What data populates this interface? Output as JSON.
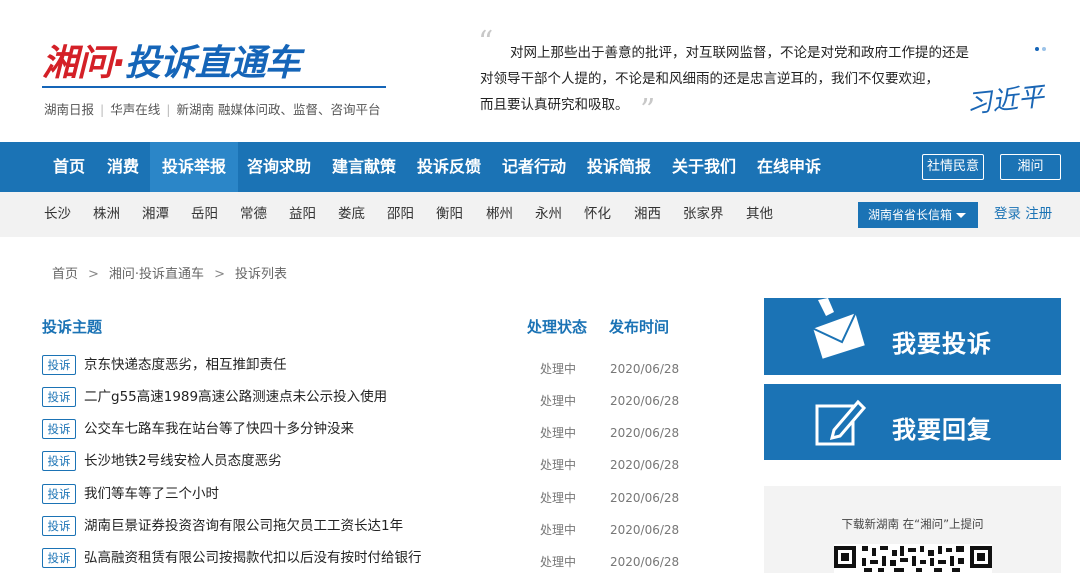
{
  "header": {
    "logo_red": "湘问",
    "logo_dot": "·",
    "logo_blue": "投诉直通车",
    "tagline": [
      "湖南日报",
      "华声在线",
      "新湖南 融媒体问政、监督、咨询平台"
    ],
    "quote_line1": "对网上那些出于善意的批评，对互联网监督，不论是对党和政府工作提的还是",
    "quote_line2": "对领导干部个人提的，不论是和风细雨的还是忠言逆耳的，我们不仅要欢迎，",
    "quote_line3": "而且要认真研究和吸取。",
    "signature": "习近平"
  },
  "mainnav": {
    "items": [
      "首页",
      "消费",
      "投诉举报",
      "咨询求助",
      "建言献策",
      "投诉反馈",
      "记者行动",
      "投诉简报",
      "关于我们",
      "在线申诉"
    ],
    "btn_shequ": "社情民意",
    "btn_xiangwen": "湘问"
  },
  "regionnav": {
    "regions": [
      "长沙",
      "株洲",
      "湘潭",
      "岳阳",
      "常德",
      "益阳",
      "娄底",
      "邵阳",
      "衡阳",
      "郴州",
      "永州",
      "怀化",
      "湘西",
      "张家界",
      "其他"
    ],
    "mailbox": "湖南省省长信箱",
    "login": "登录",
    "register": "注册"
  },
  "breadcrumb": [
    "首页",
    "湘问·投诉直通车",
    "投诉列表"
  ],
  "list": {
    "col_subject": "投诉主题",
    "col_status": "处理状态",
    "col_date": "发布时间",
    "rows": [
      {
        "tag": "投诉",
        "title": "京东快递态度恶劣，相互推卸责任",
        "status": "处理中",
        "date": "2020/06/28"
      },
      {
        "tag": "投诉",
        "title": "二广g55高速1989高速公路测速点未公示投入使用",
        "status": "处理中",
        "date": "2020/06/28"
      },
      {
        "tag": "投诉",
        "title": "公交车七路车我在站台等了快四十多分钟没来",
        "status": "处理中",
        "date": "2020/06/28"
      },
      {
        "tag": "投诉",
        "title": "长沙地铁2号线安检人员态度恶劣",
        "status": "处理中",
        "date": "2020/06/28"
      },
      {
        "tag": "投诉",
        "title": "我们等车等了三个小时",
        "status": "处理中",
        "date": "2020/06/28"
      },
      {
        "tag": "投诉",
        "title": "湖南巨景证券投资咨询有限公司拖欠员工工资长达1年",
        "status": "处理中",
        "date": "2020/06/28"
      },
      {
        "tag": "投诉",
        "title": "弘高融资租赁有限公司按揭款代扣以后没有按时付给银行",
        "status": "处理中",
        "date": "2020/06/28"
      }
    ]
  },
  "side": {
    "complain": "我要投诉",
    "reply": "我要回复",
    "promo": "下载新湖南 在“湘问”上提问"
  },
  "colors": {
    "brand_blue": "#1b73b5",
    "logo_red": "#d42027"
  }
}
